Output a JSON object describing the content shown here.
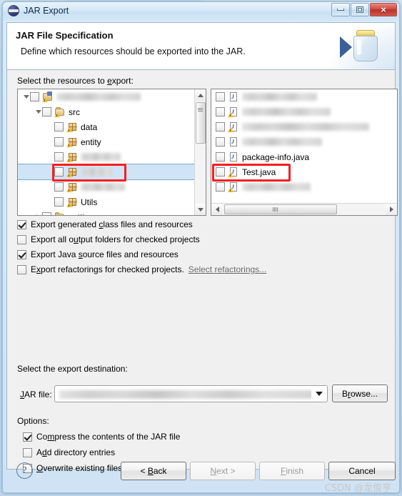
{
  "window": {
    "title": "JAR Export",
    "app_icon": "eclipse-icon",
    "controls": {
      "minimize": "minimize-icon",
      "maximize": "maximize-icon",
      "close": "×"
    }
  },
  "banner": {
    "title": "JAR File Specification",
    "description": "Define which resources should be exported into the JAR.",
    "art_icon": "jar-icon"
  },
  "resources": {
    "label": "Select the resources to export:",
    "left_tree": [
      {
        "indent": 0,
        "twisty": "open",
        "checked": false,
        "icon": "java-project-icon",
        "label": "",
        "blurred": true,
        "blur_width": 118,
        "warn": true
      },
      {
        "indent": 1,
        "twisty": "open",
        "checked": false,
        "icon": "source-folder-icon",
        "label": "src",
        "blurred": false,
        "warn": true
      },
      {
        "indent": 2,
        "twisty": "none",
        "checked": false,
        "icon": "package-icon",
        "label": "data",
        "blurred": false,
        "warn": true
      },
      {
        "indent": 2,
        "twisty": "none",
        "checked": false,
        "icon": "package-icon",
        "label": "entity",
        "blurred": false,
        "warn": true
      },
      {
        "indent": 2,
        "twisty": "none",
        "checked": false,
        "icon": "package-icon",
        "label": "",
        "blurred": true,
        "blur_width": 56,
        "warn": true
      },
      {
        "indent": 2,
        "twisty": "none",
        "checked": false,
        "icon": "package-icon",
        "label": "",
        "blurred": true,
        "blur_width": 44,
        "warn": true,
        "selected": true
      },
      {
        "indent": 2,
        "twisty": "none",
        "checked": false,
        "icon": "package-icon",
        "label": "",
        "blurred": true,
        "blur_width": 62,
        "warn": true
      },
      {
        "indent": 2,
        "twisty": "none",
        "checked": false,
        "icon": "package-icon",
        "label": "Utils",
        "blurred": false,
        "warn": true
      },
      {
        "indent": 1,
        "twisty": "closed",
        "checked": false,
        "icon": "folder-icon",
        "label": "settings",
        "blurred": false,
        "warn": false
      }
    ],
    "right_list": [
      {
        "checked": false,
        "icon": "java-file-icon",
        "label": "",
        "blurred": true,
        "blur_width": 105,
        "warn": false
      },
      {
        "checked": false,
        "icon": "java-file-icon",
        "label": "",
        "blurred": true,
        "blur_width": 124,
        "warn": true
      },
      {
        "checked": false,
        "icon": "java-file-icon",
        "label": "",
        "blurred": true,
        "blur_width": 178,
        "warn": true
      },
      {
        "checked": false,
        "icon": "java-file-icon",
        "label": "",
        "blurred": true,
        "blur_width": 112,
        "warn": false
      },
      {
        "checked": false,
        "icon": "java-file-icon",
        "label": "package-info.java",
        "blurred": false,
        "warn": false
      },
      {
        "checked": false,
        "icon": "java-file-icon",
        "label": "Test.java",
        "blurred": false,
        "warn": true,
        "highlighted": true
      },
      {
        "checked": false,
        "icon": "java-file-icon",
        "label": "",
        "blurred": true,
        "blur_width": 96,
        "warn": true
      }
    ]
  },
  "export_options": [
    {
      "label": "Export generated class files and resources",
      "checked": true,
      "mnemonic": "c"
    },
    {
      "label": "Export all output folders for checked projects",
      "checked": false,
      "mnemonic": "u"
    },
    {
      "label": "Export Java source files and resources",
      "checked": true,
      "mnemonic": "s"
    },
    {
      "label": "Export refactorings for checked projects.",
      "checked": false,
      "mnemonic": "x",
      "link": "Select refactorings..."
    }
  ],
  "destination": {
    "label": "Select the export destination:",
    "jar_file_label": "JAR file:",
    "jar_file_value": "",
    "jar_file_blurred": true,
    "dropdown_icon": "chevron-down-icon",
    "browse_label": "Browse..."
  },
  "options": {
    "label": "Options:",
    "items": [
      {
        "label": "Compress the contents of the JAR file",
        "checked": true,
        "mnemonic": "m"
      },
      {
        "label": "Add directory entries",
        "checked": false,
        "mnemonic": "d"
      },
      {
        "label": "Overwrite existing files without warning",
        "checked": false,
        "mnemonic": "O"
      }
    ]
  },
  "footer": {
    "help_icon": "?",
    "back_label": "< Back",
    "next_label": "Next >",
    "finish_label": "Finish",
    "cancel_label": "Cancel",
    "next_disabled": true,
    "finish_disabled": true,
    "watermark": "CSDN @龙俊亨"
  },
  "colors": {
    "annotation_red": "#f61f1f",
    "selection_blue": "#cfe4f7",
    "title_text": "#0b2a4a"
  }
}
